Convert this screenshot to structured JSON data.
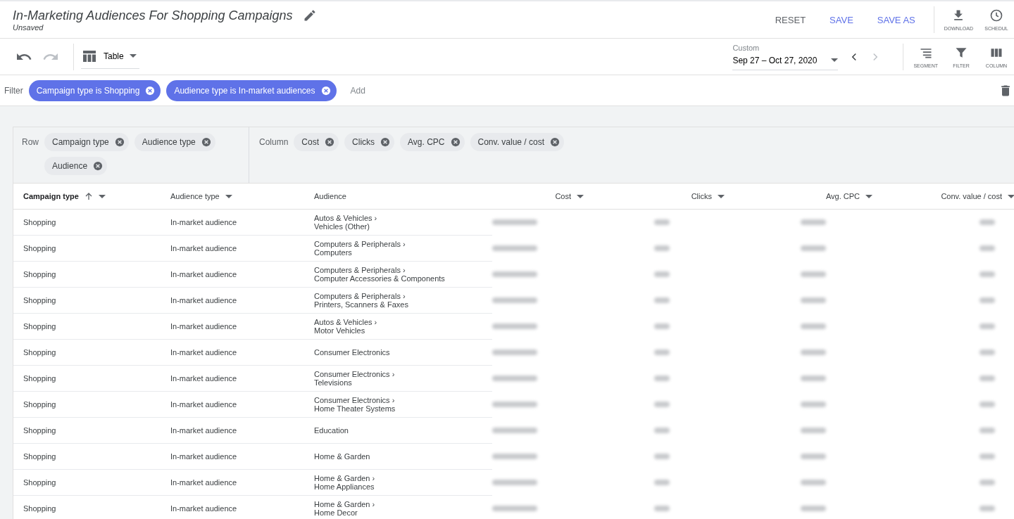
{
  "header": {
    "title": "In-Marketing Audiences For Shopping Campaigns",
    "status": "Unsaved",
    "actions": [
      {
        "label": "RESET",
        "kind": "plain"
      },
      {
        "label": "SAVE",
        "kind": "primary"
      },
      {
        "label": "SAVE AS",
        "kind": "primary"
      }
    ],
    "tools": [
      {
        "label": "DOWNLOAD",
        "kind": "download"
      },
      {
        "label": "SCHEDUL",
        "kind": "schedule"
      }
    ]
  },
  "toolbar": {
    "view": "Table",
    "date_label": "Custom",
    "date_range": "Sep 27 – Oct 27, 2020",
    "tools": [
      {
        "label": "SEGMENT",
        "kind": "segment"
      },
      {
        "label": "FILTER",
        "kind": "filter"
      },
      {
        "label": "COLUMN",
        "kind": "columns"
      }
    ]
  },
  "filters": {
    "label": "Filter",
    "chips": [
      "Campaign type is Shopping",
      "Audience type is In-market audiences"
    ],
    "add": "Add"
  },
  "pivot": {
    "row_label": "Row",
    "rows": [
      "Campaign type",
      "Audience type",
      "Audience"
    ],
    "column_label": "Column",
    "columns": [
      "Cost",
      "Clicks",
      "Avg. CPC",
      "Conv. value / cost"
    ]
  },
  "table": {
    "columns": [
      {
        "label": "Campaign type",
        "sorted": true
      },
      {
        "label": "Audience type",
        "sorted": false
      },
      {
        "label": "Audience",
        "sorted": false
      },
      {
        "label": "Cost",
        "sorted": false
      },
      {
        "label": "Clicks",
        "sorted": false
      },
      {
        "label": "Avg. CPC",
        "sorted": false
      },
      {
        "label": "Conv. value / cost",
        "sorted": false
      }
    ],
    "rows": [
      {
        "campaign_type": "Shopping",
        "audience_type": "In-market audience",
        "audience": [
          "Autos & Vehicles ›",
          "Vehicles (Other)"
        ]
      },
      {
        "campaign_type": "Shopping",
        "audience_type": "In-market audience",
        "audience": [
          "Computers & Peripherals ›",
          "Computers"
        ]
      },
      {
        "campaign_type": "Shopping",
        "audience_type": "In-market audience",
        "audience": [
          "Computers & Peripherals ›",
          "Computer Accessories & Components"
        ]
      },
      {
        "campaign_type": "Shopping",
        "audience_type": "In-market audience",
        "audience": [
          "Computers & Peripherals ›",
          "Printers, Scanners & Faxes"
        ]
      },
      {
        "campaign_type": "Shopping",
        "audience_type": "In-market audience",
        "audience": [
          "Autos & Vehicles ›",
          "Motor Vehicles"
        ]
      },
      {
        "campaign_type": "Shopping",
        "audience_type": "In-market audience",
        "audience": [
          "Consumer Electronics"
        ]
      },
      {
        "campaign_type": "Shopping",
        "audience_type": "In-market audience",
        "audience": [
          "Consumer Electronics ›",
          "Televisions"
        ]
      },
      {
        "campaign_type": "Shopping",
        "audience_type": "In-market audience",
        "audience": [
          "Consumer Electronics ›",
          "Home Theater Systems"
        ]
      },
      {
        "campaign_type": "Shopping",
        "audience_type": "In-market audience",
        "audience": [
          "Education"
        ]
      },
      {
        "campaign_type": "Shopping",
        "audience_type": "In-market audience",
        "audience": [
          "Home & Garden"
        ]
      },
      {
        "campaign_type": "Shopping",
        "audience_type": "In-market audience",
        "audience": [
          "Home & Garden ›",
          "Home Appliances"
        ]
      },
      {
        "campaign_type": "Shopping",
        "audience_type": "In-market audience",
        "audience": [
          "Home & Garden ›",
          "Home Decor"
        ]
      }
    ]
  }
}
